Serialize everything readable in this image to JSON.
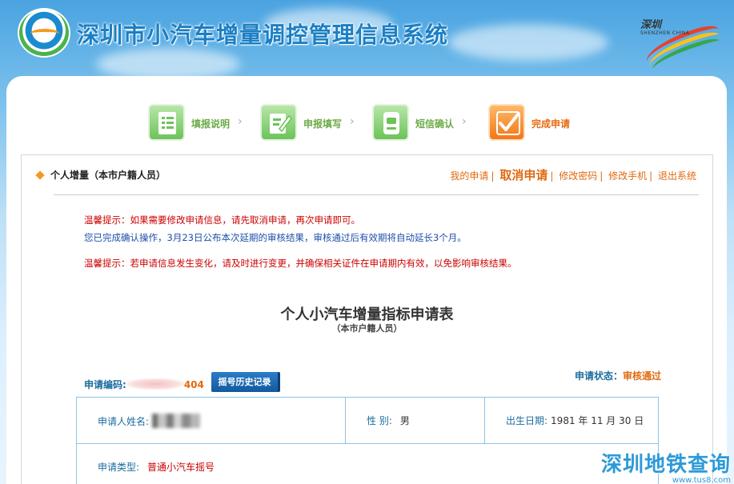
{
  "header": {
    "title": "深圳市小汽车增量调控管理信息系统",
    "city_logo_cn": "深圳",
    "city_logo_en": "SHENZHEN CHINA"
  },
  "steps": [
    {
      "label": "填报说明",
      "icon": "document-icon",
      "state": "completed"
    },
    {
      "label": "申报填写",
      "icon": "form-edit-icon",
      "state": "completed"
    },
    {
      "label": "短信确认",
      "icon": "sms-phone-icon",
      "state": "completed"
    },
    {
      "label": "完成申请",
      "icon": "checkmark-icon",
      "state": "current"
    }
  ],
  "bar": {
    "title": "个人增量（本市户籍人员）",
    "links": {
      "my_application": "我的申请",
      "cancel_application": "取消申请",
      "change_password": "修改密码",
      "change_phone": "修改手机",
      "logout": "退出系统"
    }
  },
  "notices": {
    "tip1": "温馨提示：如果需要修改申请信息，请先取消申请，再次申请即可。",
    "info": "您已完成确认操作，3月23日公布本次延期的审核结果，审核通过后有效期将自动延长3个月。",
    "tip2": "温馨提示：若申请信息发生变化，请及时进行变更，并确保相关证件在申请期内有效，以免影响审核结果。"
  },
  "form": {
    "title": "个人小汽车增量指标申请表",
    "subtitle": "（本市户籍人员）",
    "code_label": "申请编码:",
    "code_suffix": "404",
    "history_button": "摇号历史记录",
    "status_label": "申请状态：",
    "status_value": "审核通过",
    "name_label": "申请人姓名:",
    "gender_label": "性  别:",
    "gender_value": "男",
    "birth_label": "出生日期:",
    "birth_value": "1981 年 11 月 30 日",
    "type_label": "申请类型:",
    "type_value": "普通小汽车摇号"
  },
  "watermark": {
    "main": "深圳地铁查询",
    "site": "www.tus8.com"
  },
  "colors": {
    "accent_orange": "#e06a10",
    "label_blue": "#1b6d9e",
    "notice_red": "#cc0000",
    "step_green": "#6cc35a"
  }
}
